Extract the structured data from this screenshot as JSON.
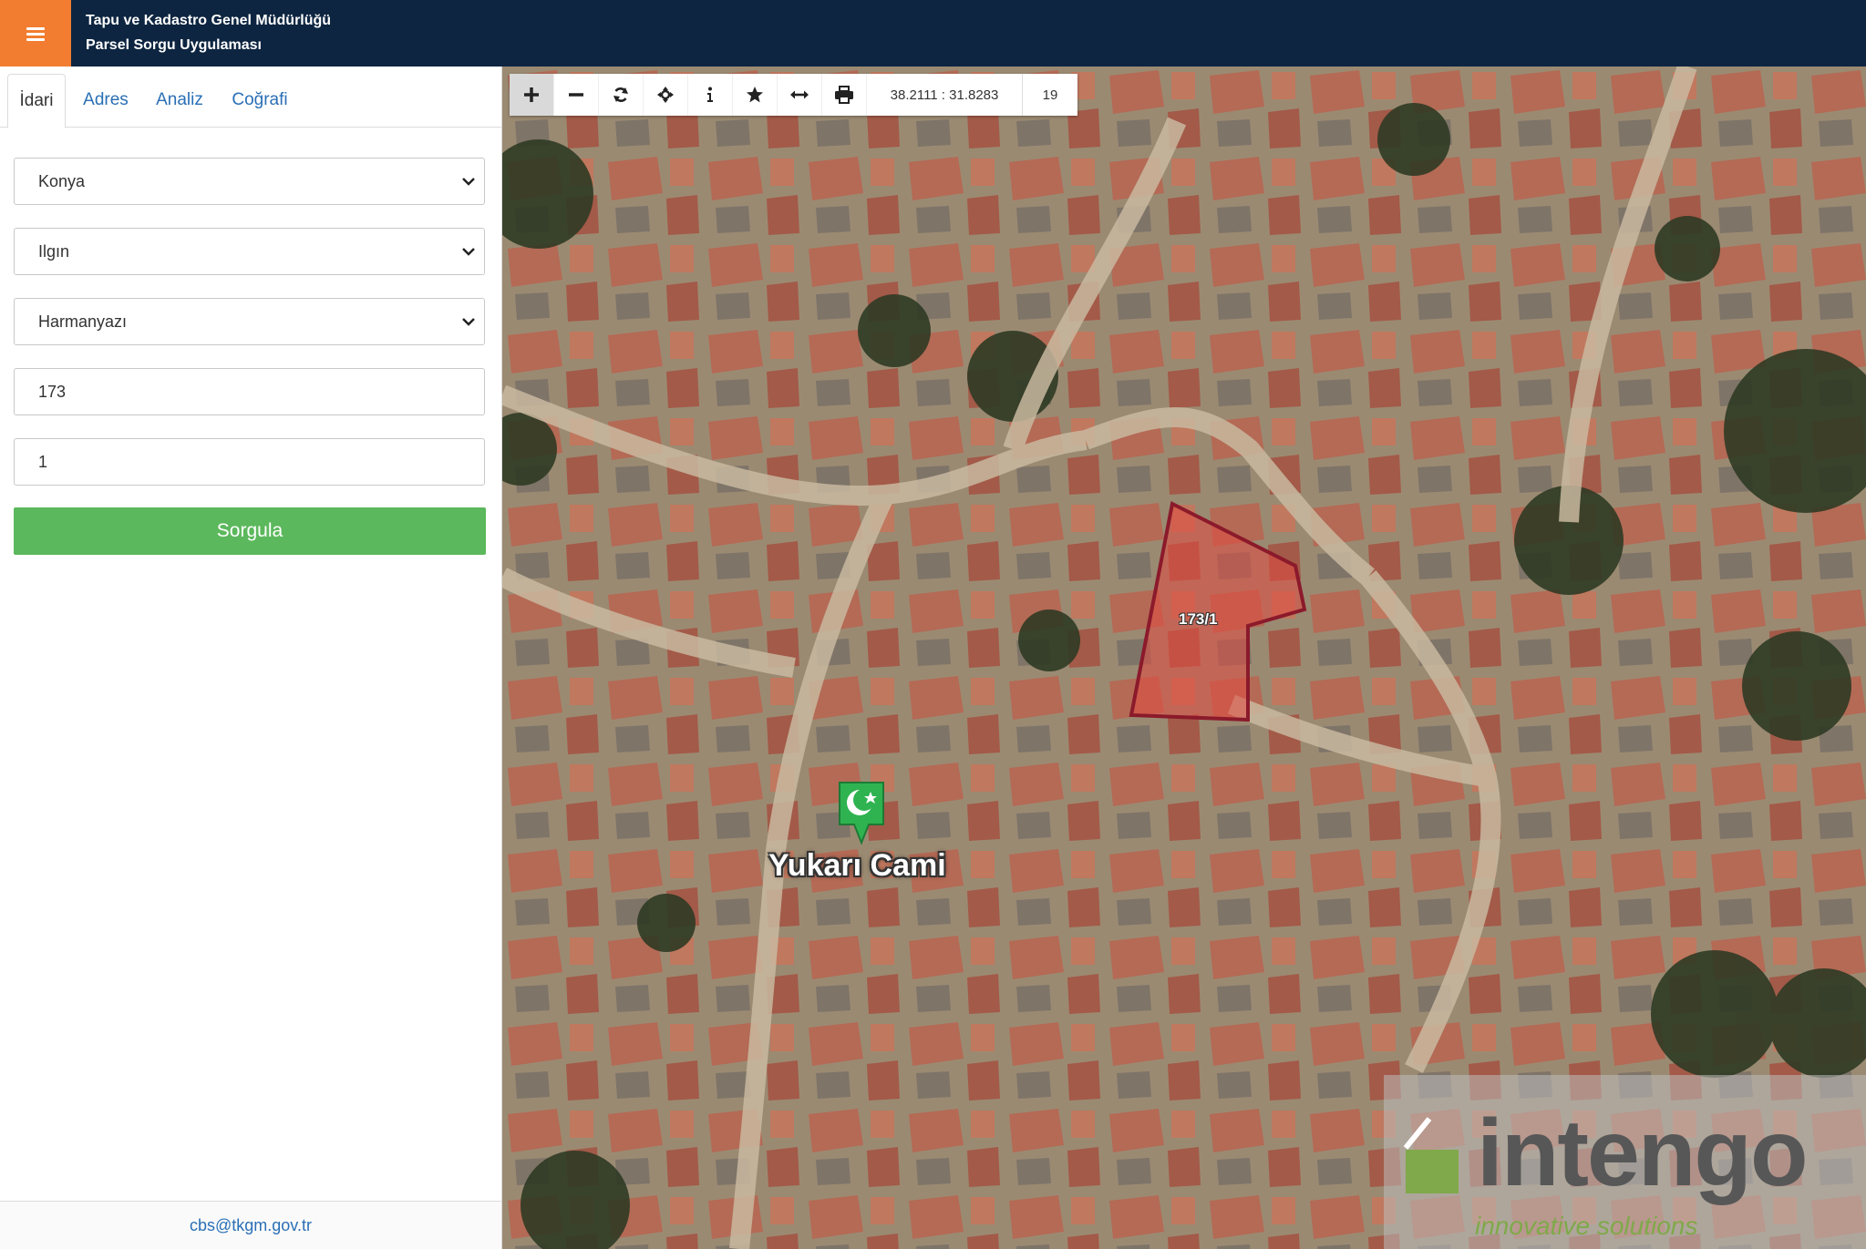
{
  "header": {
    "line1": "Tapu ve Kadastro Genel Müdürlüğü",
    "line2": "Parsel Sorgu Uygulaması",
    "menu_icon": "hamburger-icon",
    "accent": "#f27c2f",
    "bg": "#0d2540"
  },
  "tabs": [
    {
      "label": "İdari",
      "active": true
    },
    {
      "label": "Adres",
      "active": false
    },
    {
      "label": "Analiz",
      "active": false
    },
    {
      "label": "Coğrafi",
      "active": false
    }
  ],
  "form": {
    "province": "Konya",
    "district": "Ilgın",
    "neighborhood": "Harmanyazı",
    "block": "173",
    "parcel": "1",
    "submit_label": "Sorgula",
    "submit_color": "#5cb85c"
  },
  "footer": {
    "email": "cbs@tkgm.gov.tr"
  },
  "toolbar": {
    "buttons": [
      "zoom-in-icon",
      "zoom-out-icon",
      "refresh-icon",
      "move-icon",
      "info-icon",
      "star-icon",
      "measure-icon",
      "print-icon"
    ],
    "coordinates": "38.2111 : 31.8283",
    "zoom_level": "19"
  },
  "map": {
    "parcel_label": "173/1",
    "parcel_color": "#8b1a2b",
    "poi_label": "Yukarı Cami",
    "poi_icon": "mosque-marker-icon",
    "logo_word": "intengo",
    "logo_tagline": "innovative solutions"
  }
}
